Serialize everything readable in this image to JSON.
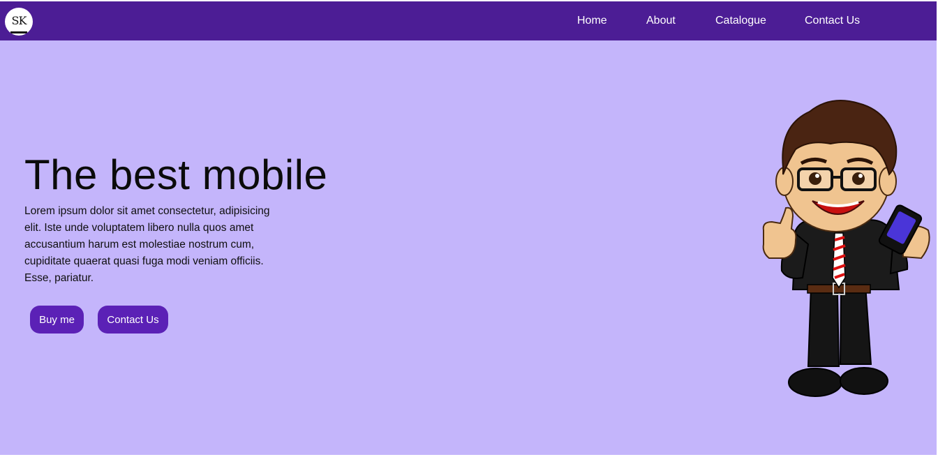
{
  "brand": {
    "logo_text": "SK"
  },
  "nav": {
    "items": [
      {
        "label": "Home"
      },
      {
        "label": "About"
      },
      {
        "label": "Catalogue"
      },
      {
        "label": "Contact Us"
      }
    ]
  },
  "hero": {
    "title": "The best mobile",
    "text": "Lorem ipsum dolor sit amet consectetur, adipisicing elit. Iste unde voluptatem libero nulla quos amet accusantium harum est molestiae nostrum cum, cupiditate quaerat quasi fuga modi veniam officiis. Esse, pariatur.",
    "buttons": {
      "buy_label": "Buy me",
      "contact_label": "Contact Us"
    }
  },
  "colors": {
    "navbar": "#4c1d95",
    "background": "#c4b5fb",
    "button": "#5b21b6",
    "nav_text": "#ffffff"
  },
  "illustration": {
    "name": "cartoon-businessman-with-phone",
    "icons": [
      "thumbs-up-icon",
      "smartphone-icon"
    ]
  }
}
